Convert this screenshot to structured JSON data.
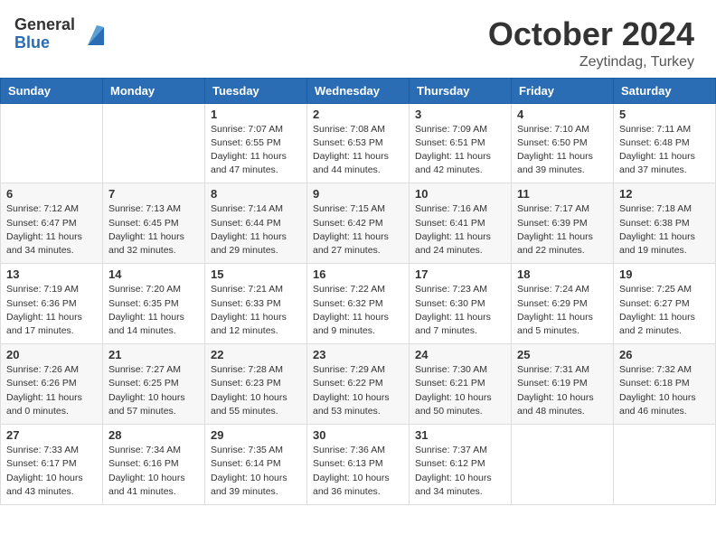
{
  "header": {
    "logo_general": "General",
    "logo_blue": "Blue",
    "month": "October 2024",
    "location": "Zeytindag, Turkey"
  },
  "weekdays": [
    "Sunday",
    "Monday",
    "Tuesday",
    "Wednesday",
    "Thursday",
    "Friday",
    "Saturday"
  ],
  "weeks": [
    [
      {
        "day": "",
        "info": ""
      },
      {
        "day": "",
        "info": ""
      },
      {
        "day": "1",
        "info": "Sunrise: 7:07 AM\nSunset: 6:55 PM\nDaylight: 11 hours and 47 minutes."
      },
      {
        "day": "2",
        "info": "Sunrise: 7:08 AM\nSunset: 6:53 PM\nDaylight: 11 hours and 44 minutes."
      },
      {
        "day": "3",
        "info": "Sunrise: 7:09 AM\nSunset: 6:51 PM\nDaylight: 11 hours and 42 minutes."
      },
      {
        "day": "4",
        "info": "Sunrise: 7:10 AM\nSunset: 6:50 PM\nDaylight: 11 hours and 39 minutes."
      },
      {
        "day": "5",
        "info": "Sunrise: 7:11 AM\nSunset: 6:48 PM\nDaylight: 11 hours and 37 minutes."
      }
    ],
    [
      {
        "day": "6",
        "info": "Sunrise: 7:12 AM\nSunset: 6:47 PM\nDaylight: 11 hours and 34 minutes."
      },
      {
        "day": "7",
        "info": "Sunrise: 7:13 AM\nSunset: 6:45 PM\nDaylight: 11 hours and 32 minutes."
      },
      {
        "day": "8",
        "info": "Sunrise: 7:14 AM\nSunset: 6:44 PM\nDaylight: 11 hours and 29 minutes."
      },
      {
        "day": "9",
        "info": "Sunrise: 7:15 AM\nSunset: 6:42 PM\nDaylight: 11 hours and 27 minutes."
      },
      {
        "day": "10",
        "info": "Sunrise: 7:16 AM\nSunset: 6:41 PM\nDaylight: 11 hours and 24 minutes."
      },
      {
        "day": "11",
        "info": "Sunrise: 7:17 AM\nSunset: 6:39 PM\nDaylight: 11 hours and 22 minutes."
      },
      {
        "day": "12",
        "info": "Sunrise: 7:18 AM\nSunset: 6:38 PM\nDaylight: 11 hours and 19 minutes."
      }
    ],
    [
      {
        "day": "13",
        "info": "Sunrise: 7:19 AM\nSunset: 6:36 PM\nDaylight: 11 hours and 17 minutes."
      },
      {
        "day": "14",
        "info": "Sunrise: 7:20 AM\nSunset: 6:35 PM\nDaylight: 11 hours and 14 minutes."
      },
      {
        "day": "15",
        "info": "Sunrise: 7:21 AM\nSunset: 6:33 PM\nDaylight: 11 hours and 12 minutes."
      },
      {
        "day": "16",
        "info": "Sunrise: 7:22 AM\nSunset: 6:32 PM\nDaylight: 11 hours and 9 minutes."
      },
      {
        "day": "17",
        "info": "Sunrise: 7:23 AM\nSunset: 6:30 PM\nDaylight: 11 hours and 7 minutes."
      },
      {
        "day": "18",
        "info": "Sunrise: 7:24 AM\nSunset: 6:29 PM\nDaylight: 11 hours and 5 minutes."
      },
      {
        "day": "19",
        "info": "Sunrise: 7:25 AM\nSunset: 6:27 PM\nDaylight: 11 hours and 2 minutes."
      }
    ],
    [
      {
        "day": "20",
        "info": "Sunrise: 7:26 AM\nSunset: 6:26 PM\nDaylight: 11 hours and 0 minutes."
      },
      {
        "day": "21",
        "info": "Sunrise: 7:27 AM\nSunset: 6:25 PM\nDaylight: 10 hours and 57 minutes."
      },
      {
        "day": "22",
        "info": "Sunrise: 7:28 AM\nSunset: 6:23 PM\nDaylight: 10 hours and 55 minutes."
      },
      {
        "day": "23",
        "info": "Sunrise: 7:29 AM\nSunset: 6:22 PM\nDaylight: 10 hours and 53 minutes."
      },
      {
        "day": "24",
        "info": "Sunrise: 7:30 AM\nSunset: 6:21 PM\nDaylight: 10 hours and 50 minutes."
      },
      {
        "day": "25",
        "info": "Sunrise: 7:31 AM\nSunset: 6:19 PM\nDaylight: 10 hours and 48 minutes."
      },
      {
        "day": "26",
        "info": "Sunrise: 7:32 AM\nSunset: 6:18 PM\nDaylight: 10 hours and 46 minutes."
      }
    ],
    [
      {
        "day": "27",
        "info": "Sunrise: 7:33 AM\nSunset: 6:17 PM\nDaylight: 10 hours and 43 minutes."
      },
      {
        "day": "28",
        "info": "Sunrise: 7:34 AM\nSunset: 6:16 PM\nDaylight: 10 hours and 41 minutes."
      },
      {
        "day": "29",
        "info": "Sunrise: 7:35 AM\nSunset: 6:14 PM\nDaylight: 10 hours and 39 minutes."
      },
      {
        "day": "30",
        "info": "Sunrise: 7:36 AM\nSunset: 6:13 PM\nDaylight: 10 hours and 36 minutes."
      },
      {
        "day": "31",
        "info": "Sunrise: 7:37 AM\nSunset: 6:12 PM\nDaylight: 10 hours and 34 minutes."
      },
      {
        "day": "",
        "info": ""
      },
      {
        "day": "",
        "info": ""
      }
    ]
  ]
}
